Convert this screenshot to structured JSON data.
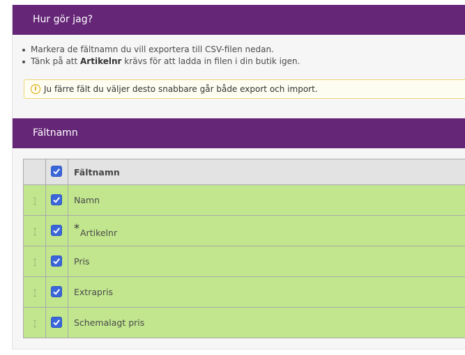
{
  "howto": {
    "title": "Hur gör jag?",
    "line1": "Markera de fältnamn du vill exportera till CSV-filen nedan.",
    "line2_prefix": "Tänk på att ",
    "line2_bold": "Artikelnr",
    "line2_suffix": " krävs för att ladda in filen i din butik igen."
  },
  "notice": {
    "icon": "info-icon",
    "text": "Ju färre fält du väljer desto snabbare går både export och import."
  },
  "fields_section": {
    "title": "Fältnamn"
  },
  "table": {
    "header": {
      "label": "Fältnamn",
      "checked": true
    },
    "rows": [
      {
        "label": "Namn",
        "checked": true,
        "required": false
      },
      {
        "label": "Artikelnr",
        "checked": true,
        "required": true,
        "required_mark": "*"
      },
      {
        "label": "Pris",
        "checked": true,
        "required": false
      },
      {
        "label": "Extrapris",
        "checked": true,
        "required": false
      },
      {
        "label": "Schemalagt pris",
        "checked": true,
        "required": false
      }
    ]
  },
  "colors": {
    "header_purple": "#652677",
    "row_green": "#c1e68e",
    "checkbox_blue": "#3b66d9",
    "notice_border": "#eed57a"
  }
}
